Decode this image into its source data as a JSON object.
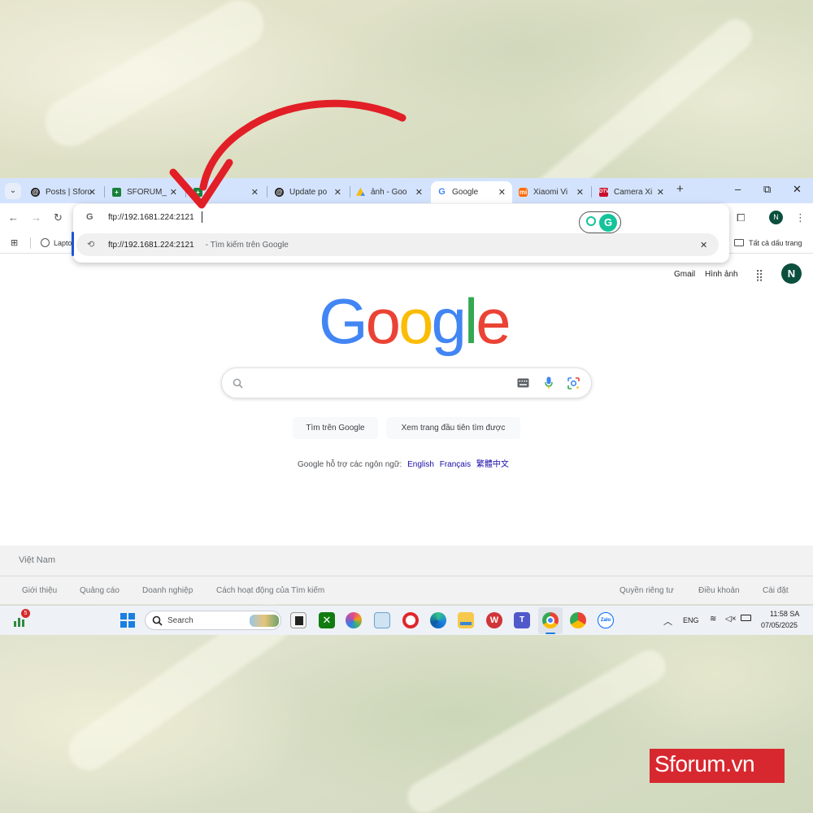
{
  "browser": {
    "tabs": [
      {
        "title": "Posts | Sforum",
        "favicon": "threads-icon"
      },
      {
        "title": "SFORUM_",
        "favicon": "sheets-icon"
      },
      {
        "title": "",
        "favicon": "sheets-icon"
      },
      {
        "title": "Update po",
        "favicon": "threads-icon"
      },
      {
        "title": "ảnh - Goo",
        "favicon": "drive-icon"
      },
      {
        "title": "Google",
        "favicon": "google-icon",
        "active": true
      },
      {
        "title": "Xiaomi Vi",
        "favicon": "mi-icon"
      },
      {
        "title": "Camera Xi",
        "favicon": "dtv-icon"
      }
    ],
    "new_tab_symbol": "+",
    "window_controls": {
      "minimize": "–",
      "restore": "⧉",
      "close": "✕"
    },
    "profile_initial": "N"
  },
  "omnibox": {
    "value": "ftp://192.1681.224:2121",
    "suggestion_url": "ftp://192.1681.224:2121",
    "suggestion_suffix": " - Tìm kiếm trên Google"
  },
  "bookmarks": {
    "first_item": "Lapto",
    "all_bookmarks": "Tất cả dấu trang"
  },
  "google": {
    "header_links": {
      "gmail": "Gmail",
      "images": "Hình ảnh"
    },
    "account_initial": "N",
    "logo_letters": [
      "G",
      "o",
      "o",
      "g",
      "l",
      "e"
    ],
    "buttons": {
      "search": "Tìm trên Google",
      "lucky": "Xem trang đầu tiên tìm được"
    },
    "languages_prefix": "Google hỗ trợ các ngôn ngữ:",
    "languages": [
      "English",
      "Français",
      "繁體中文"
    ],
    "footer": {
      "country": "Việt Nam",
      "left_links": [
        "Giới thiệu",
        "Quảng cáo",
        "Doanh nghiệp",
        "Cách hoạt động của Tìm kiếm"
      ],
      "right_links": [
        "Quyền riêng tư",
        "Điều khoản",
        "Cài đặt"
      ]
    }
  },
  "taskbar": {
    "widget_badge": "5",
    "search_placeholder": "Search",
    "language": "ENG",
    "time": "11:58 SA",
    "date": "07/05/2025"
  },
  "watermark": {
    "brand": "Sforum.vn"
  },
  "colors": {
    "google_blue": "#4285f4",
    "google_red": "#ea4335",
    "google_yellow": "#fbbc05",
    "google_green": "#34a853",
    "tab_strip": "#d3e3fd",
    "arrow_red": "#e21f26"
  }
}
